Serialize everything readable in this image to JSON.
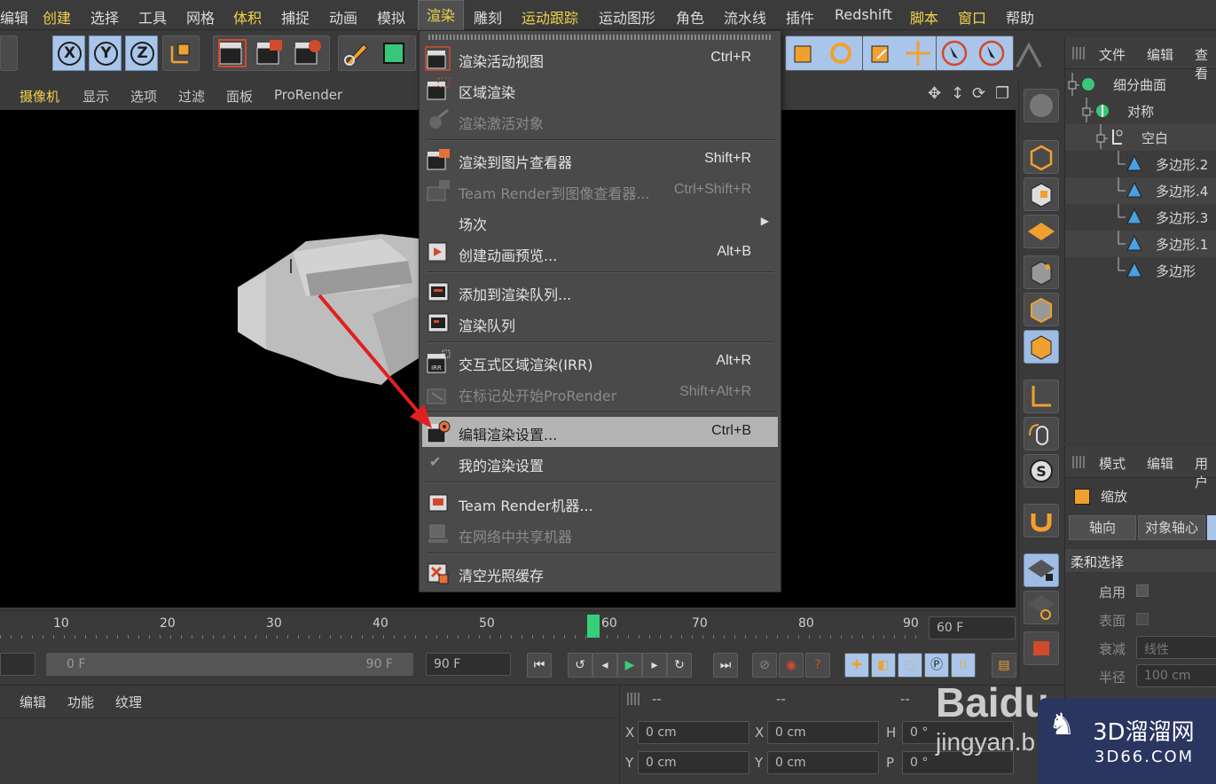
{
  "menubar": {
    "items": [
      "编辑",
      "创建",
      "选择",
      "工具",
      "网格",
      "体积",
      "捕捉",
      "动画",
      "模拟",
      "渲染",
      "雕刻",
      "运动跟踪",
      "运动图形",
      "角色",
      "流水线",
      "插件",
      "Redshift",
      "脚本",
      "窗口",
      "帮助"
    ]
  },
  "viewport_menu": [
    "摄像机",
    "显示",
    "选项",
    "过滤",
    "面板",
    "ProRender"
  ],
  "render_menu": {
    "items": [
      {
        "label": "渲染活动视图",
        "shortcut": "Ctrl+R",
        "disabled": false
      },
      {
        "label": "区域渲染",
        "shortcut": "",
        "disabled": false
      },
      {
        "label": "渲染激活对象",
        "shortcut": "",
        "disabled": true
      },
      {
        "label": "渲染到图片查看器",
        "shortcut": "Shift+R",
        "disabled": false
      },
      {
        "label": "Team Render到图像查看器...",
        "shortcut": "Ctrl+Shift+R",
        "disabled": true
      },
      {
        "label": "场次",
        "shortcut": "",
        "disabled": false
      },
      {
        "label": "创建动画预览...",
        "shortcut": "Alt+B",
        "disabled": false
      },
      {
        "label": "添加到渲染队列...",
        "shortcut": "",
        "disabled": false
      },
      {
        "label": "渲染队列",
        "shortcut": "",
        "disabled": false
      },
      {
        "label": "交互式区域渲染(IRR)",
        "shortcut": "Alt+R",
        "disabled": false
      },
      {
        "label": "在标记处开始ProRender",
        "shortcut": "Shift+Alt+R",
        "disabled": true
      },
      {
        "label": "编辑渲染设置...",
        "shortcut": "Ctrl+B",
        "disabled": false,
        "selected": true
      },
      {
        "label": "我的渲染设置",
        "shortcut": "",
        "disabled": false
      },
      {
        "label": "Team Render机器...",
        "shortcut": "",
        "disabled": false
      },
      {
        "label": "在网络中共享机器",
        "shortcut": "",
        "disabled": true
      },
      {
        "label": "清空光照缓存",
        "shortcut": "",
        "disabled": false
      }
    ]
  },
  "object_panel": {
    "tabs": [
      "文件",
      "编辑",
      "查看"
    ],
    "tree": [
      "细分曲面",
      "对称",
      "空白",
      "多边形.2",
      "多边形.4",
      "多边形.3",
      "多边形.1",
      "多边形"
    ]
  },
  "attr_panel": {
    "tabs": [
      "模式",
      "编辑",
      "用户"
    ],
    "title": "缩放",
    "subtabs": [
      "轴向",
      "对象轴心"
    ],
    "section": "柔和选择",
    "rows": [
      "启用",
      "表面",
      "衰减",
      "半径"
    ],
    "falloff_value": "线性",
    "radius_value": "100 cm"
  },
  "timeline": {
    "ticks": [
      "10",
      "20",
      "30",
      "40",
      "50",
      "60",
      "70",
      "80",
      "90"
    ],
    "end_field": "60 F",
    "start_field": "0 F",
    "range_end": "90 F",
    "max_field": "90 F"
  },
  "material_bar": [
    "编辑",
    "功能",
    "纹理"
  ],
  "coord_panel": {
    "dash": "--",
    "rows": [
      {
        "a": "X",
        "av": "0 cm",
        "b": "X",
        "bv": "0 cm",
        "c": "H",
        "cv": "0 °"
      },
      {
        "a": "Y",
        "av": "0 cm",
        "b": "Y",
        "bv": "0 cm",
        "c": "P",
        "cv": "0 °"
      }
    ]
  },
  "watermark": {
    "baidu": "Baidu",
    "jingyan": "jingyan.b",
    "brand": "3D溜溜网",
    "url": "3D66.COM"
  },
  "colors": {
    "accent": "#f2d24a",
    "menu_bg": "#4a4a4a",
    "selected": "#b4b4b4",
    "axis_blue": "#a9c6ea",
    "arrow": "#e02020"
  }
}
